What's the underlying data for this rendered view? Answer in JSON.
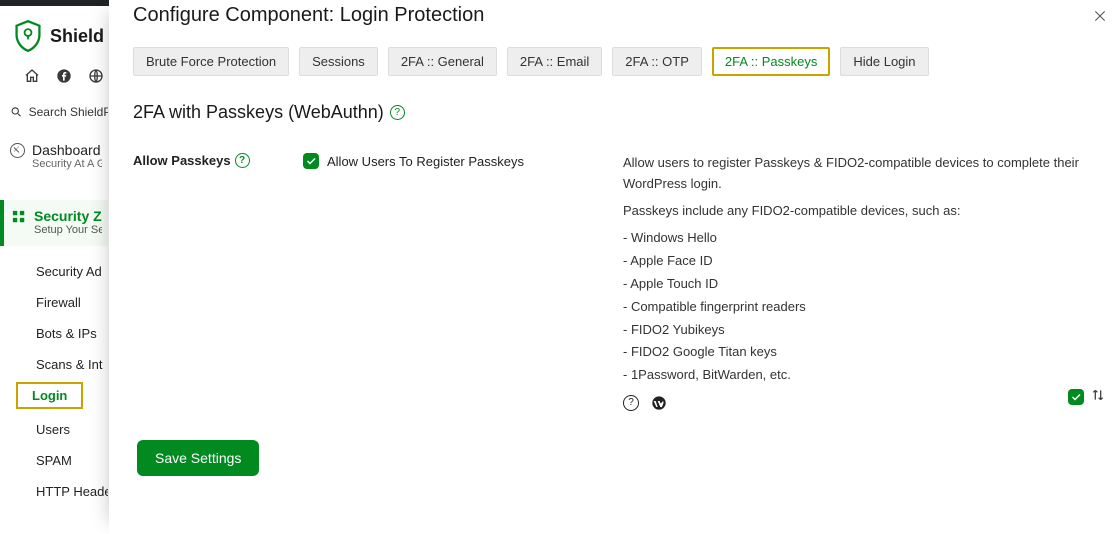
{
  "brand": {
    "name": "Shield"
  },
  "search": {
    "placeholder": "Search ShieldPRO"
  },
  "nav": {
    "dashboard": {
      "title": "Dashboard",
      "subtitle": "Security At A Glan"
    },
    "zone": {
      "title": "Security Zo",
      "subtitle": "Setup Your Securi"
    },
    "items": [
      {
        "label": "Security Ad"
      },
      {
        "label": "Firewall"
      },
      {
        "label": "Bots & IPs"
      },
      {
        "label": "Scans & Int"
      },
      {
        "label": "Login",
        "active": true
      },
      {
        "label": "Users"
      },
      {
        "label": "SPAM"
      },
      {
        "label": "HTTP Heade"
      }
    ]
  },
  "modal": {
    "title": "Configure Component: Login Protection",
    "tabs": [
      {
        "label": "Brute Force Protection"
      },
      {
        "label": "Sessions"
      },
      {
        "label": "2FA :: General"
      },
      {
        "label": "2FA :: Email"
      },
      {
        "label": "2FA :: OTP"
      },
      {
        "label": "2FA :: Passkeys",
        "active": true
      },
      {
        "label": "Hide Login"
      }
    ],
    "section_title": "2FA with Passkeys (WebAuthn)",
    "option": {
      "label": "Allow Passkeys",
      "checkbox_label": "Allow Users To Register Passkeys"
    },
    "help": {
      "p1": "Allow users to register Passkeys & FIDO2-compatible devices to complete their WordPress login.",
      "p2": "Passkeys include any FIDO2-compatible devices, such as:",
      "bullets": [
        "- Windows Hello",
        "- Apple Face ID",
        "- Apple Touch ID",
        "- Compatible fingerprint readers",
        "- FIDO2 Yubikeys",
        "- FIDO2 Google Titan keys",
        "- 1Password, BitWarden, etc."
      ]
    },
    "save_label": "Save Settings"
  }
}
